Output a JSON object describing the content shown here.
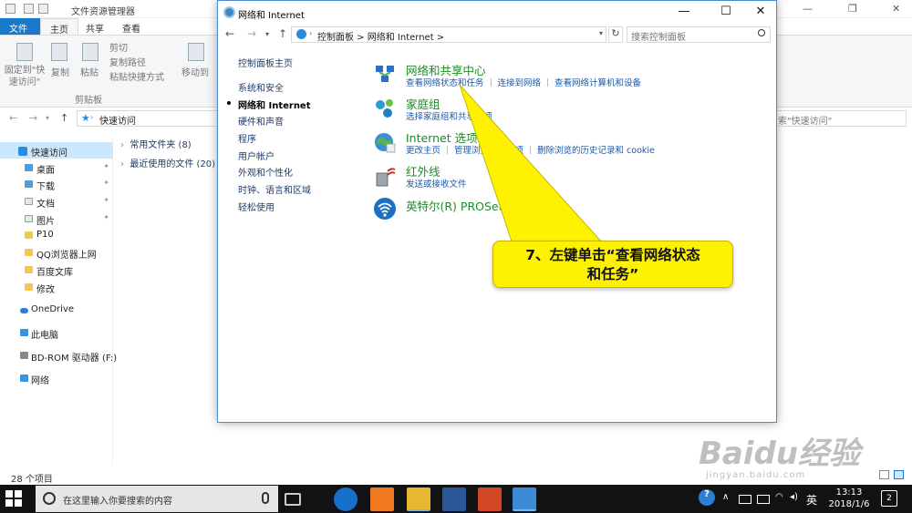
{
  "explorer": {
    "title": "文件资源管理器",
    "tabs": [
      "文件",
      "主页",
      "共享",
      "查看"
    ],
    "ribbon": {
      "pin_label": "固定到\"快\n速访问\"",
      "copy": "复制",
      "paste": "粘贴",
      "cut": "剪切",
      "copy_path": "复制路径",
      "paste_shortcut": "粘贴快捷方式",
      "move_to": "移动到",
      "clipboard_group": "剪贴板"
    },
    "address": "快速访问",
    "search_placeholder": "索\"快速访问\"",
    "sidebar": [
      {
        "label": "快速访问"
      },
      {
        "label": "桌面"
      },
      {
        "label": "下载"
      },
      {
        "label": "文档"
      },
      {
        "label": "图片"
      },
      {
        "label": "P10"
      },
      {
        "label": "QQ浏览器上网"
      },
      {
        "label": "百度文库"
      },
      {
        "label": "修改"
      },
      {
        "label": "OneDrive"
      },
      {
        "label": "此电脑"
      },
      {
        "label": "BD-ROM 驱动器 (F:)"
      },
      {
        "label": "网络"
      }
    ],
    "groups": [
      "常用文件夹 (8)",
      "最近使用的文件 (20)"
    ],
    "status": "28 个项目"
  },
  "control_panel": {
    "title": "网络和 Internet",
    "breadcrumb": "控制面板  >  网络和 Internet  >",
    "search_placeholder": "搜索控制面板",
    "left_links": [
      "控制面板主页",
      "系统和安全",
      "网络和 Internet",
      "硬件和声音",
      "程序",
      "用户帐户",
      "外观和个性化",
      "时钟、语言和区域",
      "轻松使用"
    ],
    "categories": [
      {
        "title": "网络和共享中心",
        "links": [
          "查看网络状态和任务",
          "连接到网络",
          "查看网络计算机和设备"
        ]
      },
      {
        "title": "家庭组",
        "links": [
          "选择家庭组和共享选项"
        ]
      },
      {
        "title": "Internet 选项",
        "links": [
          "更改主页",
          "管理浏览器加载项",
          "删除浏览的历史记录和 cookie"
        ]
      },
      {
        "title": "红外线",
        "links": [
          "发送或接收文件"
        ]
      },
      {
        "title": "英特尔(R) PROSet/无线工具",
        "links": []
      }
    ]
  },
  "callout": {
    "line1": "7、左键单击“查看网络状态",
    "line2": "和任务”"
  },
  "taskbar": {
    "search_placeholder": "在这里输入你要搜索的内容",
    "ime": "英",
    "time": "13:13",
    "date": "2018/1/6",
    "notifications": "2"
  },
  "watermark": {
    "brand": "Baidu经验",
    "url": "jingyan.baidu.com"
  }
}
